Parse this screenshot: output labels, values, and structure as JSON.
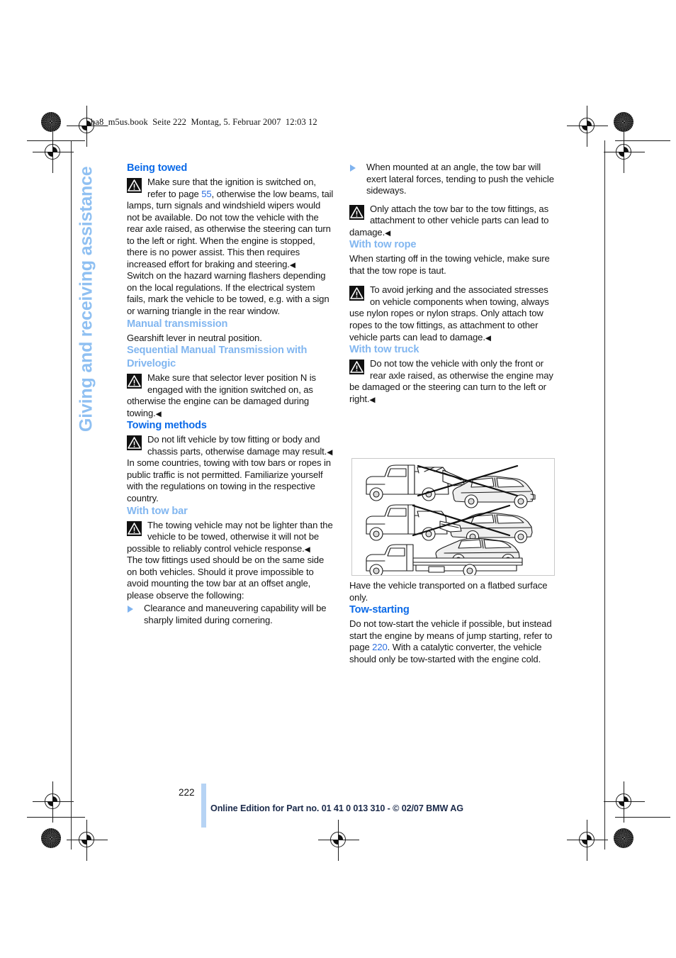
{
  "file_header": "ba8_m5us.book  Seite 222  Montag, 5. Februar 2007  12:03 12",
  "side_title": "Giving and receiving assistance",
  "footer": {
    "page_number": "222",
    "text": "Online Edition for Part no. 01 41 0 013 310 - © 02/07 BMW AG"
  },
  "colors": {
    "heading_main": "#0b6ae8",
    "heading_sub": "#81b6f0",
    "page_ref_link": "#2d6fe0",
    "side_title": "#8fc0f2",
    "folio_bar": "#b6d3f4",
    "footer_text": "#1b2a4a",
    "bullet_triangle": "#7fb3ef"
  },
  "left_column": {
    "heading_being_towed": "Being towed",
    "note_ignition": {
      "text_before_ref": "Make sure that the ignition is switched on, refer to page ",
      "page_ref": "55",
      "text_after_ref": ", otherwise the low beams, tail lamps, turn signals and windshield wipers would not be available. Do not tow the vehicle with the rear axle raised, as otherwise the steering can turn to the left or right. When the engine is stopped, there is no power assist. This then requires increased effort for braking and steering.",
      "end_mark": "◀"
    },
    "para_hazard": "Switch on the hazard warning flashers depending on the local regulations. If the electrical system fails, mark the vehicle to be towed, e.g. with a sign or warning triangle in the rear window.",
    "heading_manual_transmission": "Manual transmission",
    "para_gearshift": "Gearshift lever in neutral position.",
    "heading_smg": "Sequential Manual Transmission with Drivelogic",
    "note_selector": {
      "text": "Make sure that selector lever position N is engaged with the ignition switched on, as otherwise the engine can be damaged during towing.",
      "end_mark": "◀"
    },
    "heading_towing_methods": "Towing methods",
    "note_do_not_lift": {
      "text": "Do not lift vehicle by tow fitting or body and chassis parts, otherwise damage may result.",
      "end_mark": "◀"
    },
    "para_countries": "In some countries, towing with tow bars or ropes in public traffic is not permitted. Familiarize yourself with the regulations on towing in the respective country.",
    "heading_with_tow_bar": "With tow bar",
    "note_towing_vehicle_weight": {
      "text": "The towing vehicle may not be lighter than the vehicle to be towed, otherwise it will not be possible to reliably control vehicle response.",
      "end_mark": "◀"
    },
    "para_tow_fittings": "The tow fittings used should be on the same side on both vehicles. Should it prove impossible to avoid mounting the tow bar at an offset angle, please observe the following:",
    "bullets": [
      "Clearance and maneuvering capability will be sharply limited during cornering."
    ]
  },
  "right_column": {
    "bullets": [
      "When mounted at an angle, the tow bar will exert lateral forces, tending to push the vehicle sideways."
    ],
    "note_only_attach_bar": {
      "text": "Only attach the tow bar to the tow fittings, as attachment to other vehicle parts can lead to damage.",
      "end_mark": "◀"
    },
    "heading_with_tow_rope": "With tow rope",
    "para_starting_off": "When starting off in the towing vehicle, make sure that the tow rope is taut.",
    "note_avoid_jerking": {
      "text": "To avoid jerking and the associated stresses on vehicle components when towing, always use nylon ropes or nylon straps. Only attach tow ropes to the tow fittings, as attachment to other vehicle parts can lead to damage.",
      "end_mark": "◀"
    },
    "heading_with_tow_truck": "With tow truck",
    "note_axle_raised": {
      "text": "Do not tow the vehicle with only the front or rear axle raised, as otherwise the engine may be damaged or the steering can turn to the left or right.",
      "end_mark": "◀"
    },
    "figure": {
      "caption_alt": "Three tow truck methods: front axle raised (not allowed), rear axle raised (not allowed), flatbed transport (allowed)",
      "id_label": ""
    },
    "para_flatbed": "Have the vehicle transported on a flatbed surface only.",
    "heading_tow_starting": "Tow-starting",
    "para_tow_starting": {
      "text_before_ref": "Do not tow-start the vehicle if possible, but instead start the engine by means of jump starting, refer to page ",
      "page_ref": "220",
      "text_after_ref": ". With a catalytic converter, the vehicle should only be tow-started with the engine cold."
    }
  }
}
